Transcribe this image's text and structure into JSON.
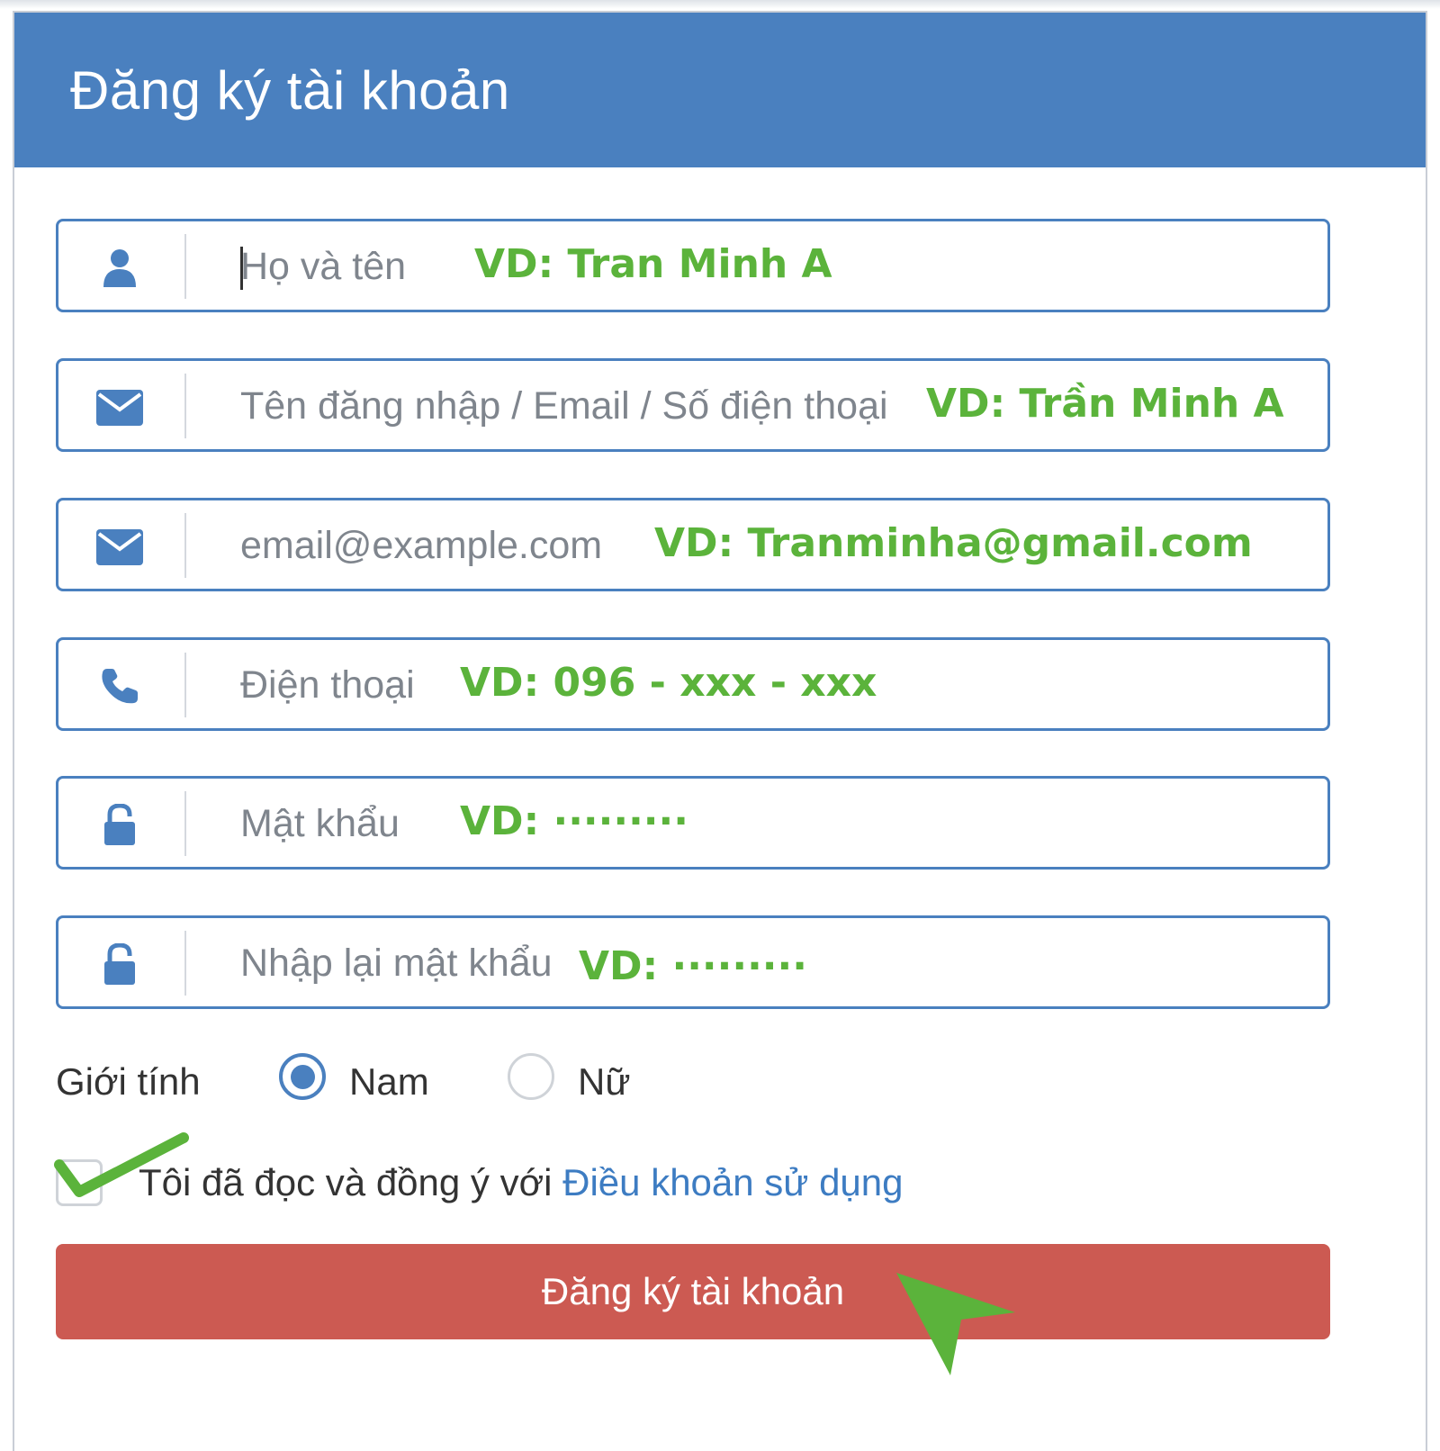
{
  "form": {
    "title": "Đăng ký tài khoản",
    "fields": [
      {
        "placeholder": "Họ và tên",
        "hint": "VD: Tran Minh A",
        "icon": "user-icon"
      },
      {
        "placeholder": "Tên đăng nhập / Email / Số điện thoại",
        "hint": "VD: Trần Minh A",
        "icon": "envelope-icon"
      },
      {
        "placeholder": "email@example.com",
        "hint": "VD: Tranminha@gmail.com",
        "icon": "envelope-icon"
      },
      {
        "placeholder": "Điện thoại",
        "hint": "VD: 096 - xxx - xxx",
        "icon": "phone-icon"
      },
      {
        "placeholder": "Mật khẩu",
        "hint": "VD: ·········",
        "icon": "unlock-icon"
      },
      {
        "placeholder": "Nhập lại mật khẩu",
        "hint": "VD: ·········",
        "icon": "unlock-icon"
      }
    ],
    "gender": {
      "label": "Giới tính",
      "options": [
        "Nam",
        "Nữ"
      ],
      "selected": "Nam"
    },
    "terms": {
      "text": "Tôi đã đọc và đồng ý với",
      "link": "Điều khoản sử dụng"
    },
    "submit_label": "Đăng ký tài khoản"
  },
  "colors": {
    "header": "#4a80bf",
    "field_border": "#4a80bf",
    "hint": "#5bb33b",
    "submit": "#cc5a52",
    "link": "#3d7cc2"
  }
}
